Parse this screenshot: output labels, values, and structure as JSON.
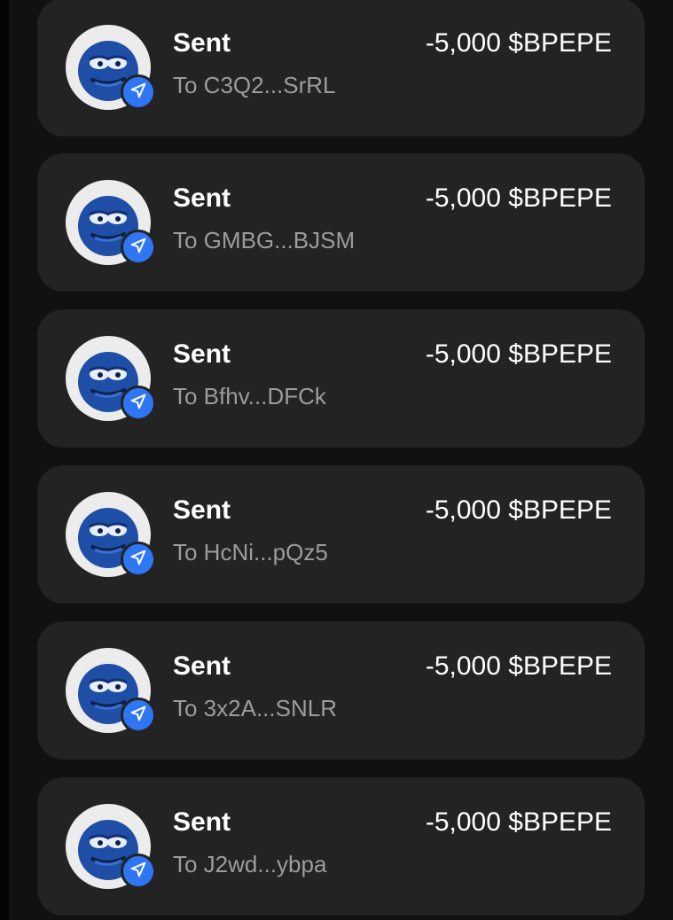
{
  "colors": {
    "background": "#111111",
    "card": "#232323",
    "title": "#ffffff",
    "secondary_text": "#9c9c9c",
    "badge_blue": "#2f76f5",
    "token_avatar_blue": "#1f4ea6"
  },
  "transactions": [
    {
      "status": "Sent",
      "recipient": "To C3Q2...SrRL",
      "amount": "-5,000 $BPEPE",
      "icon": "pepe-token-avatar",
      "badge_icon": "send-arrow-icon"
    },
    {
      "status": "Sent",
      "recipient": "To GMBG...BJSM",
      "amount": "-5,000 $BPEPE",
      "icon": "pepe-token-avatar",
      "badge_icon": "send-arrow-icon"
    },
    {
      "status": "Sent",
      "recipient": "To Bfhv...DFCk",
      "amount": "-5,000 $BPEPE",
      "icon": "pepe-token-avatar",
      "badge_icon": "send-arrow-icon"
    },
    {
      "status": "Sent",
      "recipient": "To HcNi...pQz5",
      "amount": "-5,000 $BPEPE",
      "icon": "pepe-token-avatar",
      "badge_icon": "send-arrow-icon"
    },
    {
      "status": "Sent",
      "recipient": "To 3x2A...SNLR",
      "amount": "-5,000 $BPEPE",
      "icon": "pepe-token-avatar",
      "badge_icon": "send-arrow-icon"
    },
    {
      "status": "Sent",
      "recipient": "To J2wd...ybpa",
      "amount": "-5,000 $BPEPE",
      "icon": "pepe-token-avatar",
      "badge_icon": "send-arrow-icon"
    }
  ]
}
